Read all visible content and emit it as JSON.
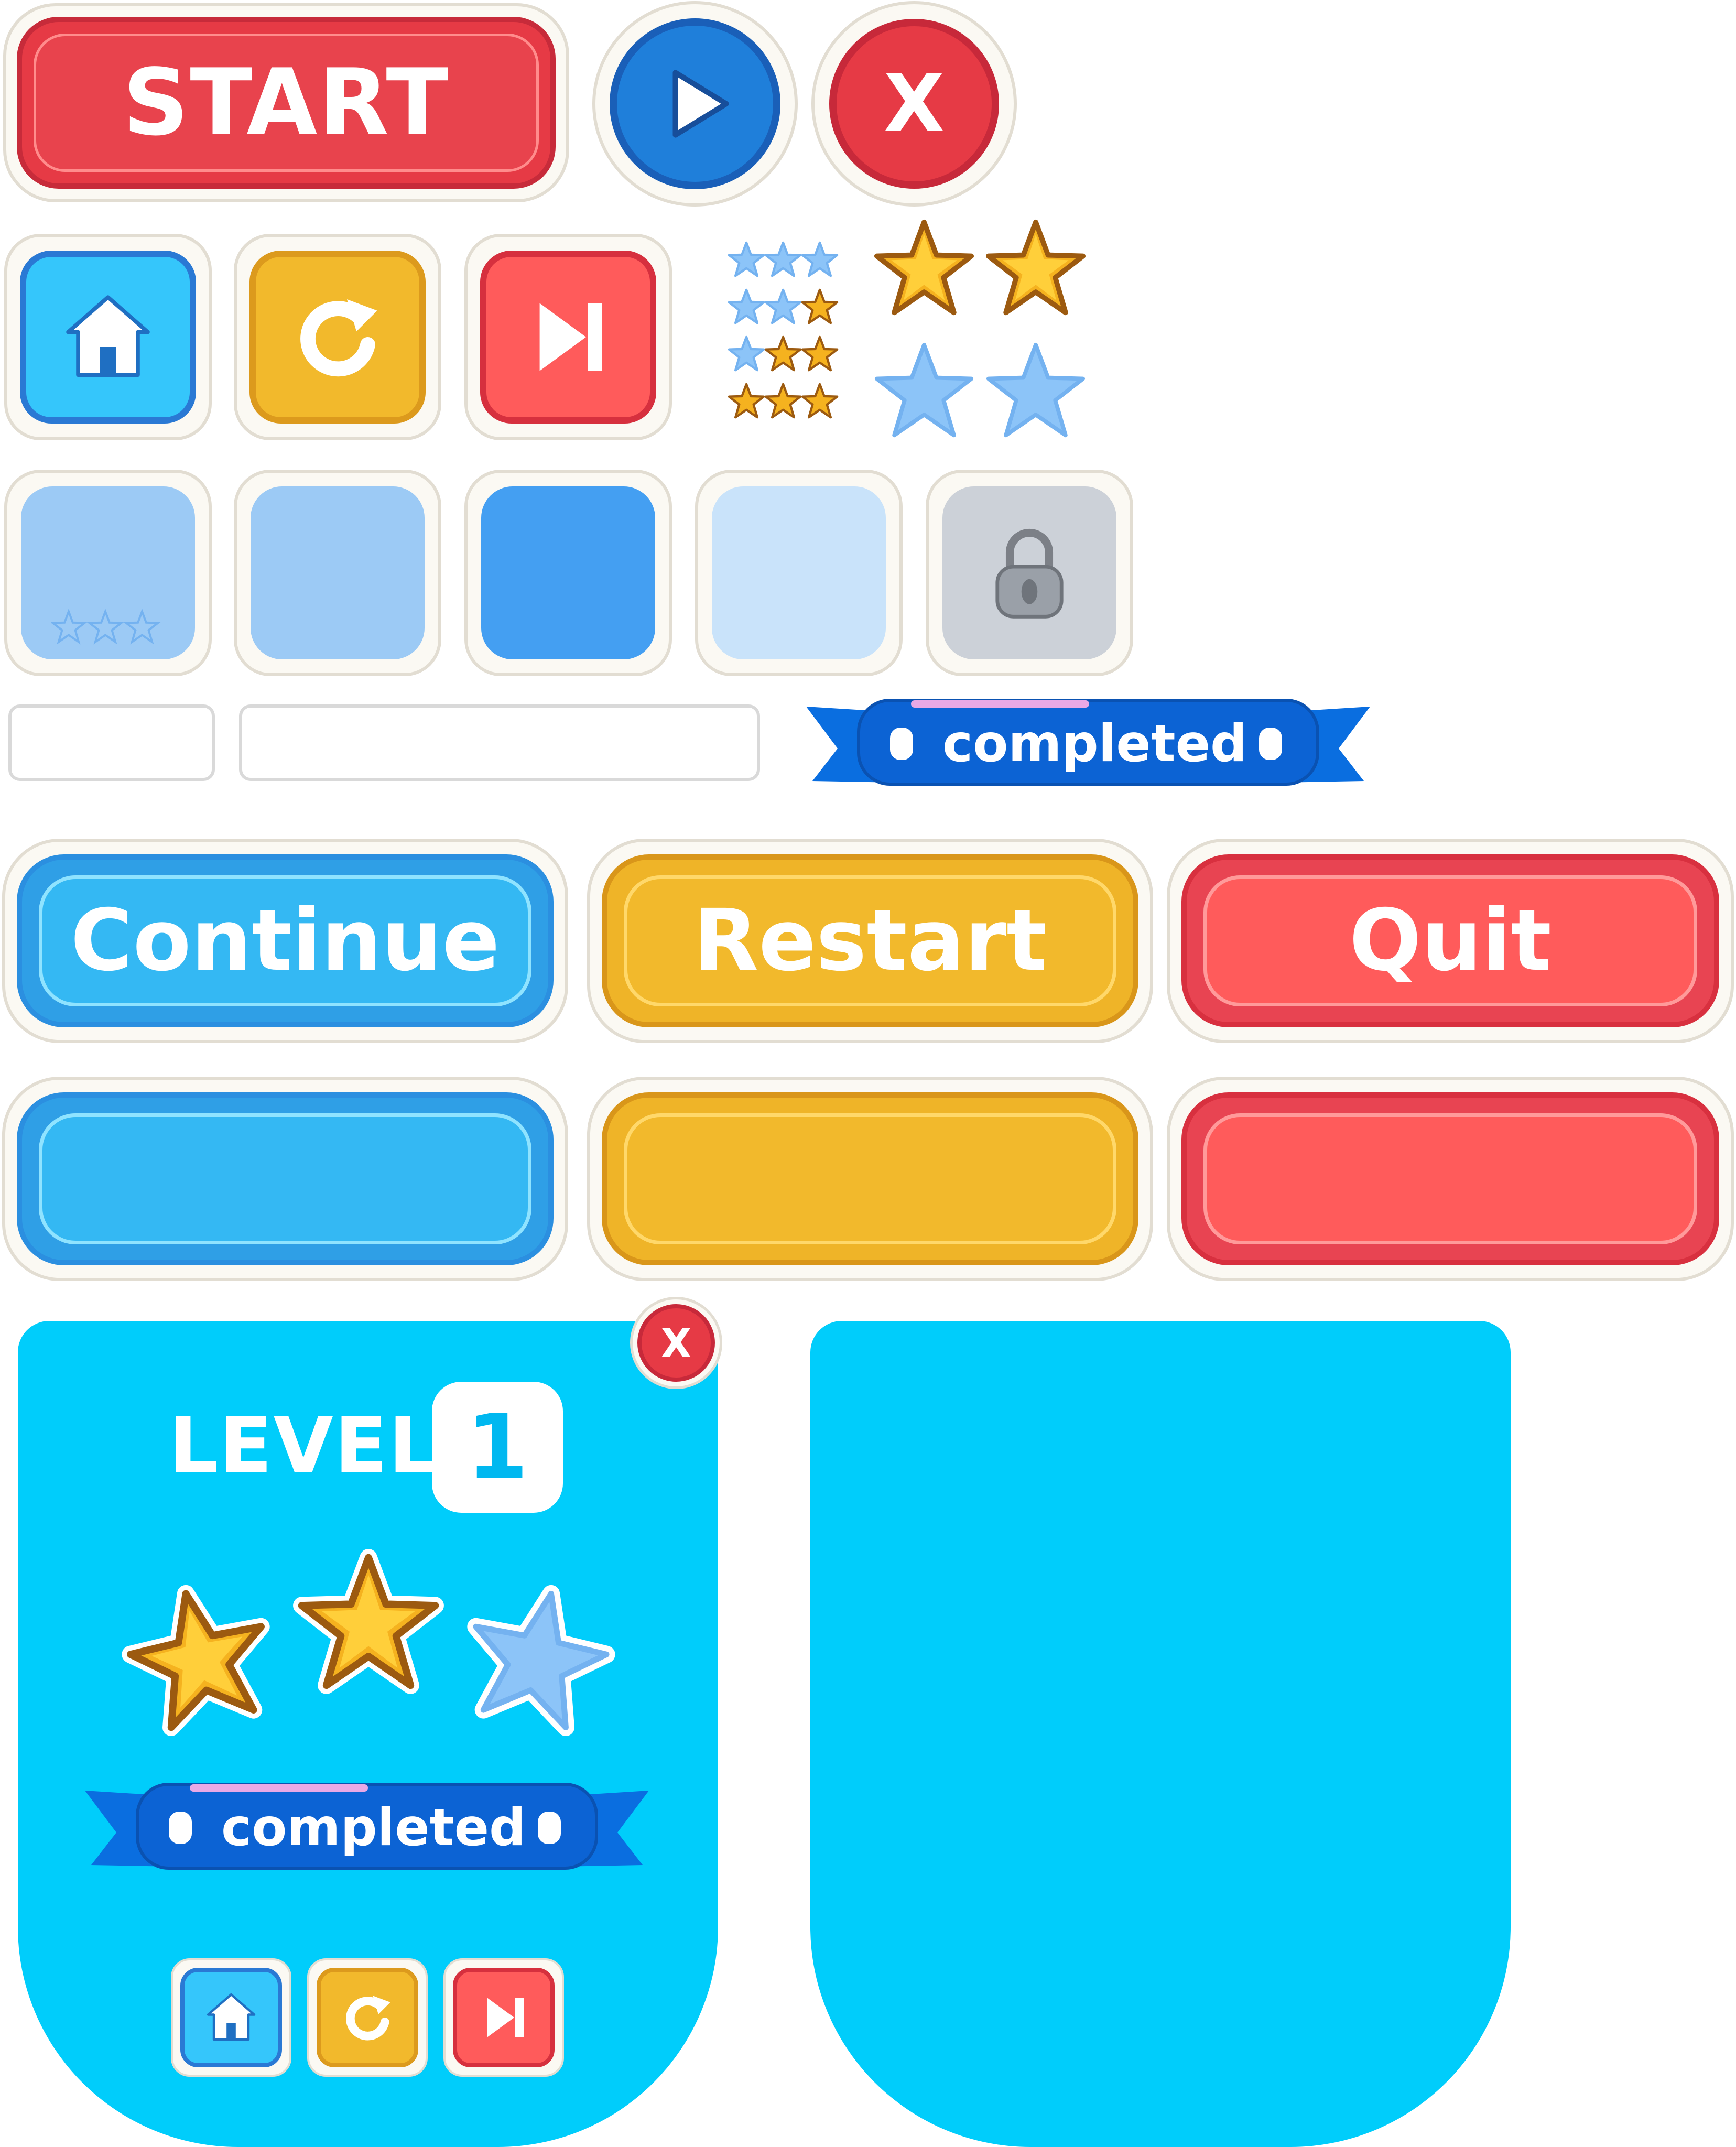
{
  "buttons": {
    "start_label": "START",
    "continue_label": "Continue",
    "restart_label": "Restart",
    "quit_label": "Quit",
    "close_glyph": "X"
  },
  "badges": {
    "completed_label": "completed"
  },
  "level_panel": {
    "title": "LEVEL",
    "number": "1",
    "stars_earned": 2,
    "stars_total": 3,
    "completed_label": "completed"
  },
  "star_rating_samples": [
    0,
    1,
    2,
    3
  ],
  "colors": {
    "blue": "#35c6fb",
    "yellow": "#f2b92c",
    "red": "#ff5b5b",
    "panel": "#00cdfb",
    "ribbon": "#0a6ee0",
    "star_gold": "#f5b21f",
    "star_empty": "#8cc4f8"
  },
  "icons": [
    "play-icon",
    "close-icon",
    "home-icon",
    "restart-icon",
    "skip-icon",
    "star-icon",
    "lock-icon"
  ]
}
